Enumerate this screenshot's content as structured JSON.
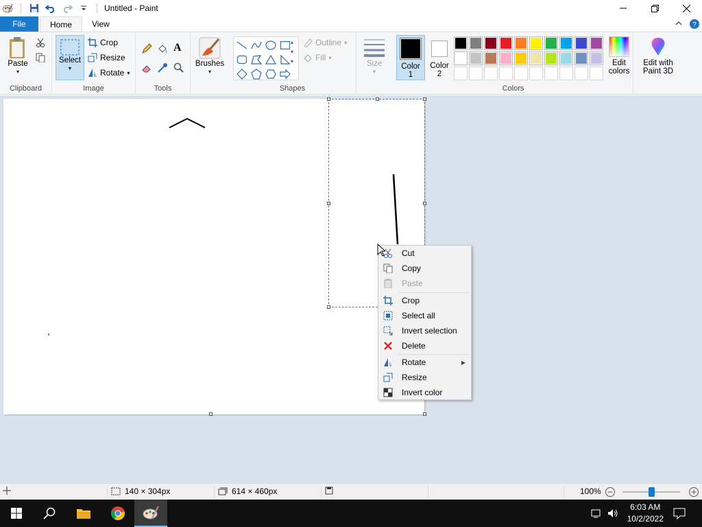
{
  "window": {
    "title": "Untitled - Paint"
  },
  "tabs": {
    "file": "File",
    "home": "Home",
    "view": "View"
  },
  "ribbon": {
    "clipboard": {
      "paste": "Paste",
      "group": "Clipboard"
    },
    "image": {
      "select": "Select",
      "crop": "Crop",
      "resize": "Resize",
      "rotate": "Rotate",
      "group": "Image"
    },
    "tools": {
      "group": "Tools"
    },
    "brushes": {
      "label": "Brushes"
    },
    "shapes": {
      "outline": "Outline",
      "fill": "Fill",
      "group": "Shapes"
    },
    "size": {
      "label": "Size"
    },
    "colors": {
      "color1_label": "Color 1",
      "color2_label": "Color 2",
      "edit_colors": "Edit colors",
      "edit_paint3d": "Edit with Paint 3D",
      "group": "Colors",
      "color1": "#000000",
      "color2": "#ffffff",
      "palette": [
        "#000000",
        "#7f7f7f",
        "#880015",
        "#ed1c24",
        "#ff7f27",
        "#fff200",
        "#22b14c",
        "#00a2e8",
        "#3f48cc",
        "#a349a4",
        "#ffffff",
        "#c3c3c3",
        "#b97a57",
        "#ffaec9",
        "#ffc90e",
        "#efe4b0",
        "#b5e61d",
        "#99d9ea",
        "#7092be",
        "#c8bfe7",
        "",
        "",
        "",
        "",
        "",
        "",
        "",
        "",
        "",
        ""
      ]
    }
  },
  "context_menu": {
    "items": [
      {
        "label": "Cut",
        "icon": "scissors-icon",
        "disabled": false
      },
      {
        "label": "Copy",
        "icon": "copy-icon",
        "disabled": false
      },
      {
        "label": "Paste",
        "icon": "paste-icon",
        "disabled": true
      },
      {
        "label": "Crop",
        "icon": "crop-icon",
        "disabled": false
      },
      {
        "label": "Select all",
        "icon": "select-all-icon",
        "disabled": false
      },
      {
        "label": "Invert selection",
        "icon": "invert-selection-icon",
        "disabled": false
      },
      {
        "label": "Delete",
        "icon": "delete-icon",
        "disabled": false
      },
      {
        "label": "Rotate",
        "icon": "rotate-icon",
        "disabled": false
      },
      {
        "label": "Resize",
        "icon": "resize-icon",
        "disabled": false
      },
      {
        "label": "Invert color",
        "icon": "invert-color-icon",
        "disabled": false
      }
    ]
  },
  "status": {
    "selection_size": "140 × 304px",
    "canvas_size": "614 × 460px",
    "zoom": "100%"
  },
  "taskbar": {
    "time": "6:03 AM",
    "date": "10/2/2022"
  }
}
